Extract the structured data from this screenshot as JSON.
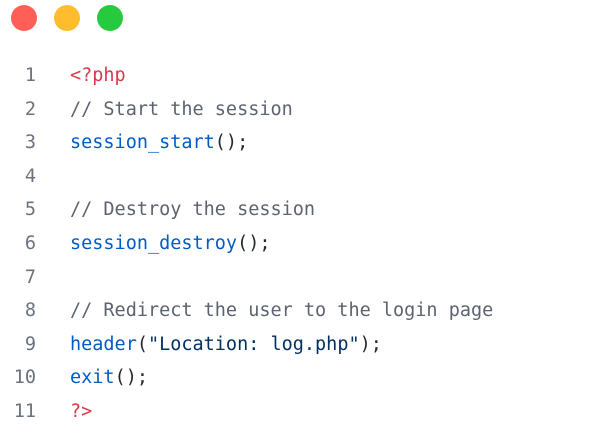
{
  "window": {
    "controls": [
      {
        "name": "close",
        "color": "#ff5f56"
      },
      {
        "name": "minimize",
        "color": "#ffbd2e"
      },
      {
        "name": "zoom",
        "color": "#27c93f"
      }
    ]
  },
  "code": {
    "language": "php",
    "lines": [
      {
        "number": "1",
        "tokens": [
          {
            "type": "tag",
            "text": "<?php"
          }
        ]
      },
      {
        "number": "2",
        "tokens": [
          {
            "type": "comment",
            "text": "// Start the session"
          }
        ]
      },
      {
        "number": "3",
        "tokens": [
          {
            "type": "fn",
            "text": "session_start"
          },
          {
            "type": "punct",
            "text": "();"
          }
        ]
      },
      {
        "number": "4",
        "tokens": []
      },
      {
        "number": "5",
        "tokens": [
          {
            "type": "comment",
            "text": "// Destroy the session"
          }
        ]
      },
      {
        "number": "6",
        "tokens": [
          {
            "type": "fn",
            "text": "session_destroy"
          },
          {
            "type": "punct",
            "text": "();"
          }
        ]
      },
      {
        "number": "7",
        "tokens": []
      },
      {
        "number": "8",
        "tokens": [
          {
            "type": "comment",
            "text": "// Redirect the user to the login page"
          }
        ]
      },
      {
        "number": "9",
        "tokens": [
          {
            "type": "fn",
            "text": "header"
          },
          {
            "type": "punct",
            "text": "("
          },
          {
            "type": "string",
            "text": "\"Location: log.php\""
          },
          {
            "type": "punct",
            "text": ");"
          }
        ]
      },
      {
        "number": "10",
        "tokens": [
          {
            "type": "fn",
            "text": "exit"
          },
          {
            "type": "punct",
            "text": "();"
          }
        ]
      },
      {
        "number": "11",
        "tokens": [
          {
            "type": "tag",
            "text": "?>"
          }
        ]
      }
    ]
  }
}
